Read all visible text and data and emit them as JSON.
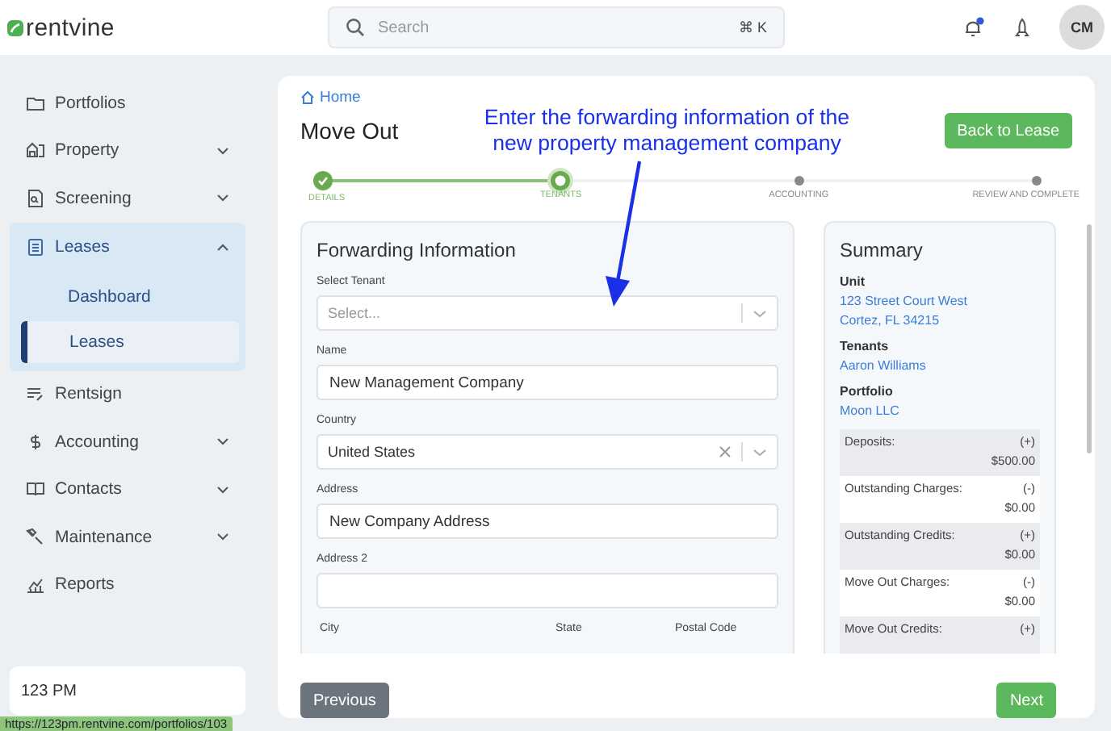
{
  "header": {
    "logo": "rentvine",
    "search": {
      "placeholder": "Search",
      "shortcut": "⌘ K"
    },
    "notification_unread": true,
    "avatar": "CM"
  },
  "sidebar": {
    "items": [
      {
        "label": "Portfolios",
        "kind": "link"
      },
      {
        "label": "Property",
        "kind": "menu",
        "expanded": false
      },
      {
        "label": "Screening",
        "kind": "menu",
        "expanded": false
      },
      {
        "label": "Leases",
        "kind": "menu",
        "expanded": true,
        "children": [
          {
            "label": "Dashboard",
            "selected": false
          },
          {
            "label": "Leases",
            "selected": true
          }
        ]
      },
      {
        "label": "Rentsign",
        "kind": "link"
      },
      {
        "label": "Accounting",
        "kind": "menu",
        "expanded": false
      },
      {
        "label": "Contacts",
        "kind": "menu",
        "expanded": false
      },
      {
        "label": "Maintenance",
        "kind": "menu",
        "expanded": false
      },
      {
        "label": "Reports",
        "kind": "link"
      }
    ],
    "company": "123 PM"
  },
  "page": {
    "breadcrumb": "Home",
    "title": "Move Out",
    "back_button": "Back to Lease",
    "steps": [
      {
        "label": "DETAILS",
        "completed": true,
        "selected": false
      },
      {
        "label": "TENANTS",
        "completed": false,
        "selected": true
      },
      {
        "label": "ACCOUNTING",
        "completed": false,
        "selected": false
      },
      {
        "label": "REVIEW AND COMPLETE",
        "completed": false,
        "selected": false
      }
    ],
    "form": {
      "title": "Forwarding Information",
      "fields": [
        {
          "kind": "select",
          "label": "Select Tenant",
          "placeholder": "Select..."
        },
        {
          "kind": "text",
          "label": "Name",
          "value": "New Management Company"
        },
        {
          "kind": "select",
          "label": "Country",
          "value": "United States",
          "clearable": true
        },
        {
          "kind": "text",
          "label": "Address",
          "value": "New Company Address"
        },
        {
          "kind": "text",
          "label": "Address 2"
        }
      ],
      "next_labels": [
        "City",
        "State",
        "Postal Code"
      ]
    },
    "summary": {
      "title": "Summary",
      "sections": [
        {
          "label": "Unit",
          "lines": [
            "123 Street Court West",
            "Cortez, FL 34215"
          ]
        },
        {
          "label": "Tenants",
          "lines": [
            "Aaron Williams"
          ]
        },
        {
          "label": "Portfolio",
          "lines": [
            "Moon LLC"
          ]
        }
      ],
      "ledger": [
        {
          "label": "Deposits:",
          "sign": "(+)",
          "amount": "$500.00"
        },
        {
          "label": "Outstanding Charges:",
          "sign": "(-)",
          "amount": "$0.00"
        },
        {
          "label": "Outstanding Credits:",
          "sign": "(+)",
          "amount": "$0.00"
        },
        {
          "label": "Move Out Charges:",
          "sign": "(-)",
          "amount": "$0.00"
        },
        {
          "label": "Move Out Credits:",
          "sign": "(+)"
        }
      ]
    },
    "previous_button": "Previous",
    "next_button": "Next"
  },
  "annotation": "Enter the forwarding information of the new property management company",
  "status_url": "https://123pm.rentvine.com/portfolios/103"
}
